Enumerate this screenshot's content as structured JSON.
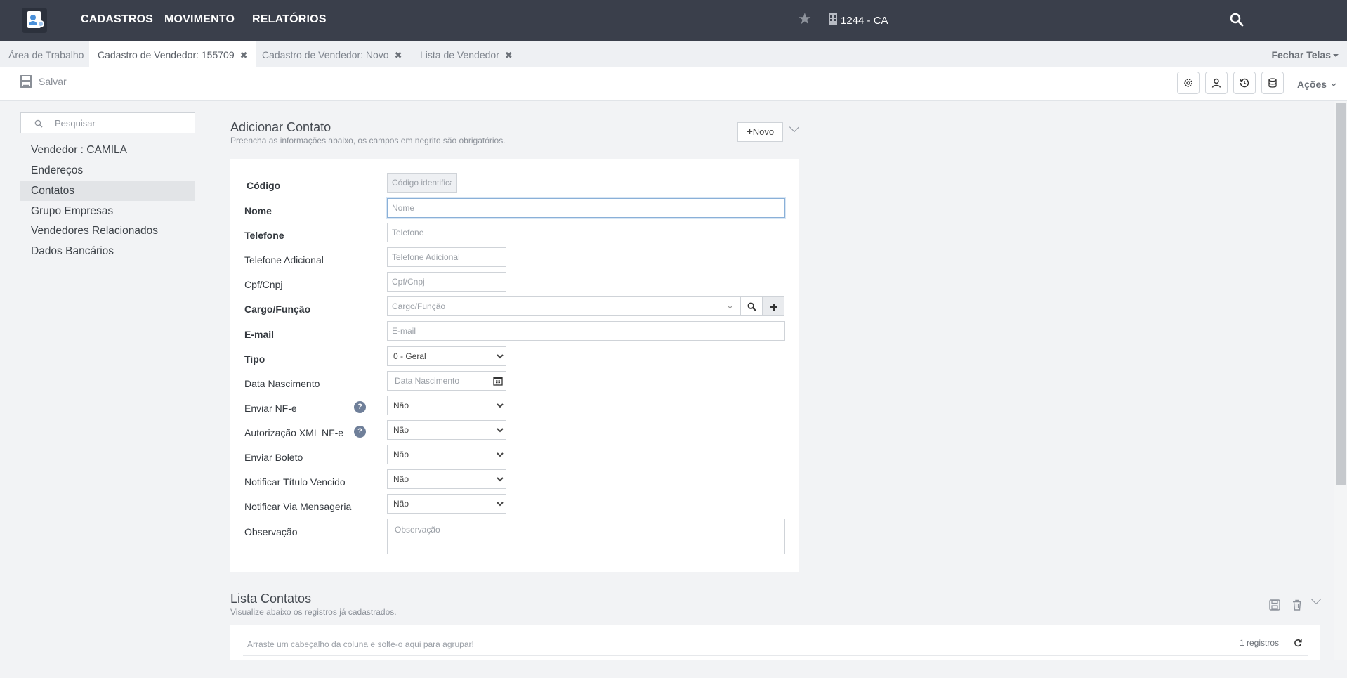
{
  "nav": {
    "items": [
      "CADASTROS",
      "MOVIMENTO",
      "RELATÓRIOS"
    ],
    "company": "1244 - CA"
  },
  "tabs": {
    "items": [
      {
        "label": "Área de Trabalho"
      },
      {
        "label": "Cadastro de Vendedor: 155709"
      },
      {
        "label": "Cadastro de Vendedor: Novo"
      },
      {
        "label": "Lista de Vendedor"
      }
    ],
    "close_glyph": "✖",
    "fechar_telas": "Fechar Telas"
  },
  "toolbar": {
    "save_label": "Salvar",
    "acoes_label": "Ações"
  },
  "sidebar": {
    "search_placeholder": "Pesquisar",
    "items": [
      {
        "label": "Vendedor : CAMILA"
      },
      {
        "label": "Endereços"
      },
      {
        "label": "Contatos"
      },
      {
        "label": "Grupo Empresas"
      },
      {
        "label": "Vendedores Relacionados"
      },
      {
        "label": "Dados Bancários"
      }
    ]
  },
  "form": {
    "title": "Adicionar Contato",
    "subtitle": "Preencha as informações abaixo, os campos em negrito são obrigatórios.",
    "novo_label": "Novo",
    "fields": {
      "codigo": {
        "label": "Código",
        "placeholder": "Código identificador"
      },
      "nome": {
        "label": "Nome",
        "placeholder": "Nome"
      },
      "telefone": {
        "label": "Telefone",
        "placeholder": "Telefone"
      },
      "telefone_adicional": {
        "label": "Telefone Adicional",
        "placeholder": "Telefone Adicional"
      },
      "cpf_cnpj": {
        "label": "Cpf/Cnpj",
        "placeholder": "Cpf/Cnpj"
      },
      "cargo": {
        "label": "Cargo/Função",
        "placeholder": "Cargo/Função"
      },
      "email": {
        "label": "E-mail",
        "placeholder": "E-mail"
      },
      "tipo": {
        "label": "Tipo",
        "value": "0 - Geral"
      },
      "data_nascimento": {
        "label": "Data Nascimento",
        "placeholder": "Data Nascimento"
      },
      "enviar_nfe": {
        "label": "Enviar NF-e",
        "value": "Não"
      },
      "autorizacao_xml": {
        "label": "Autorização XML NF-e",
        "value": "Não"
      },
      "enviar_boleto": {
        "label": "Enviar Boleto",
        "value": "Não"
      },
      "notificar_titulo": {
        "label": "Notificar Título Vencido",
        "value": "Não"
      },
      "notificar_mensageria": {
        "label": "Notificar Via Mensageria",
        "value": "Não"
      },
      "observacao": {
        "label": "Observação",
        "placeholder": "Observação"
      }
    },
    "help_glyph": "?"
  },
  "list": {
    "title": "Lista Contatos",
    "subtitle": "Visualize abaixo os registros já cadastrados.",
    "group_hint": "Arraste um cabeçalho da coluna e solte-o aqui para agrupar!",
    "records": "1 registros"
  },
  "colors": {
    "topbar": "#3a3f4b",
    "accent": "#4a90d9",
    "help": "#6f7f99"
  }
}
